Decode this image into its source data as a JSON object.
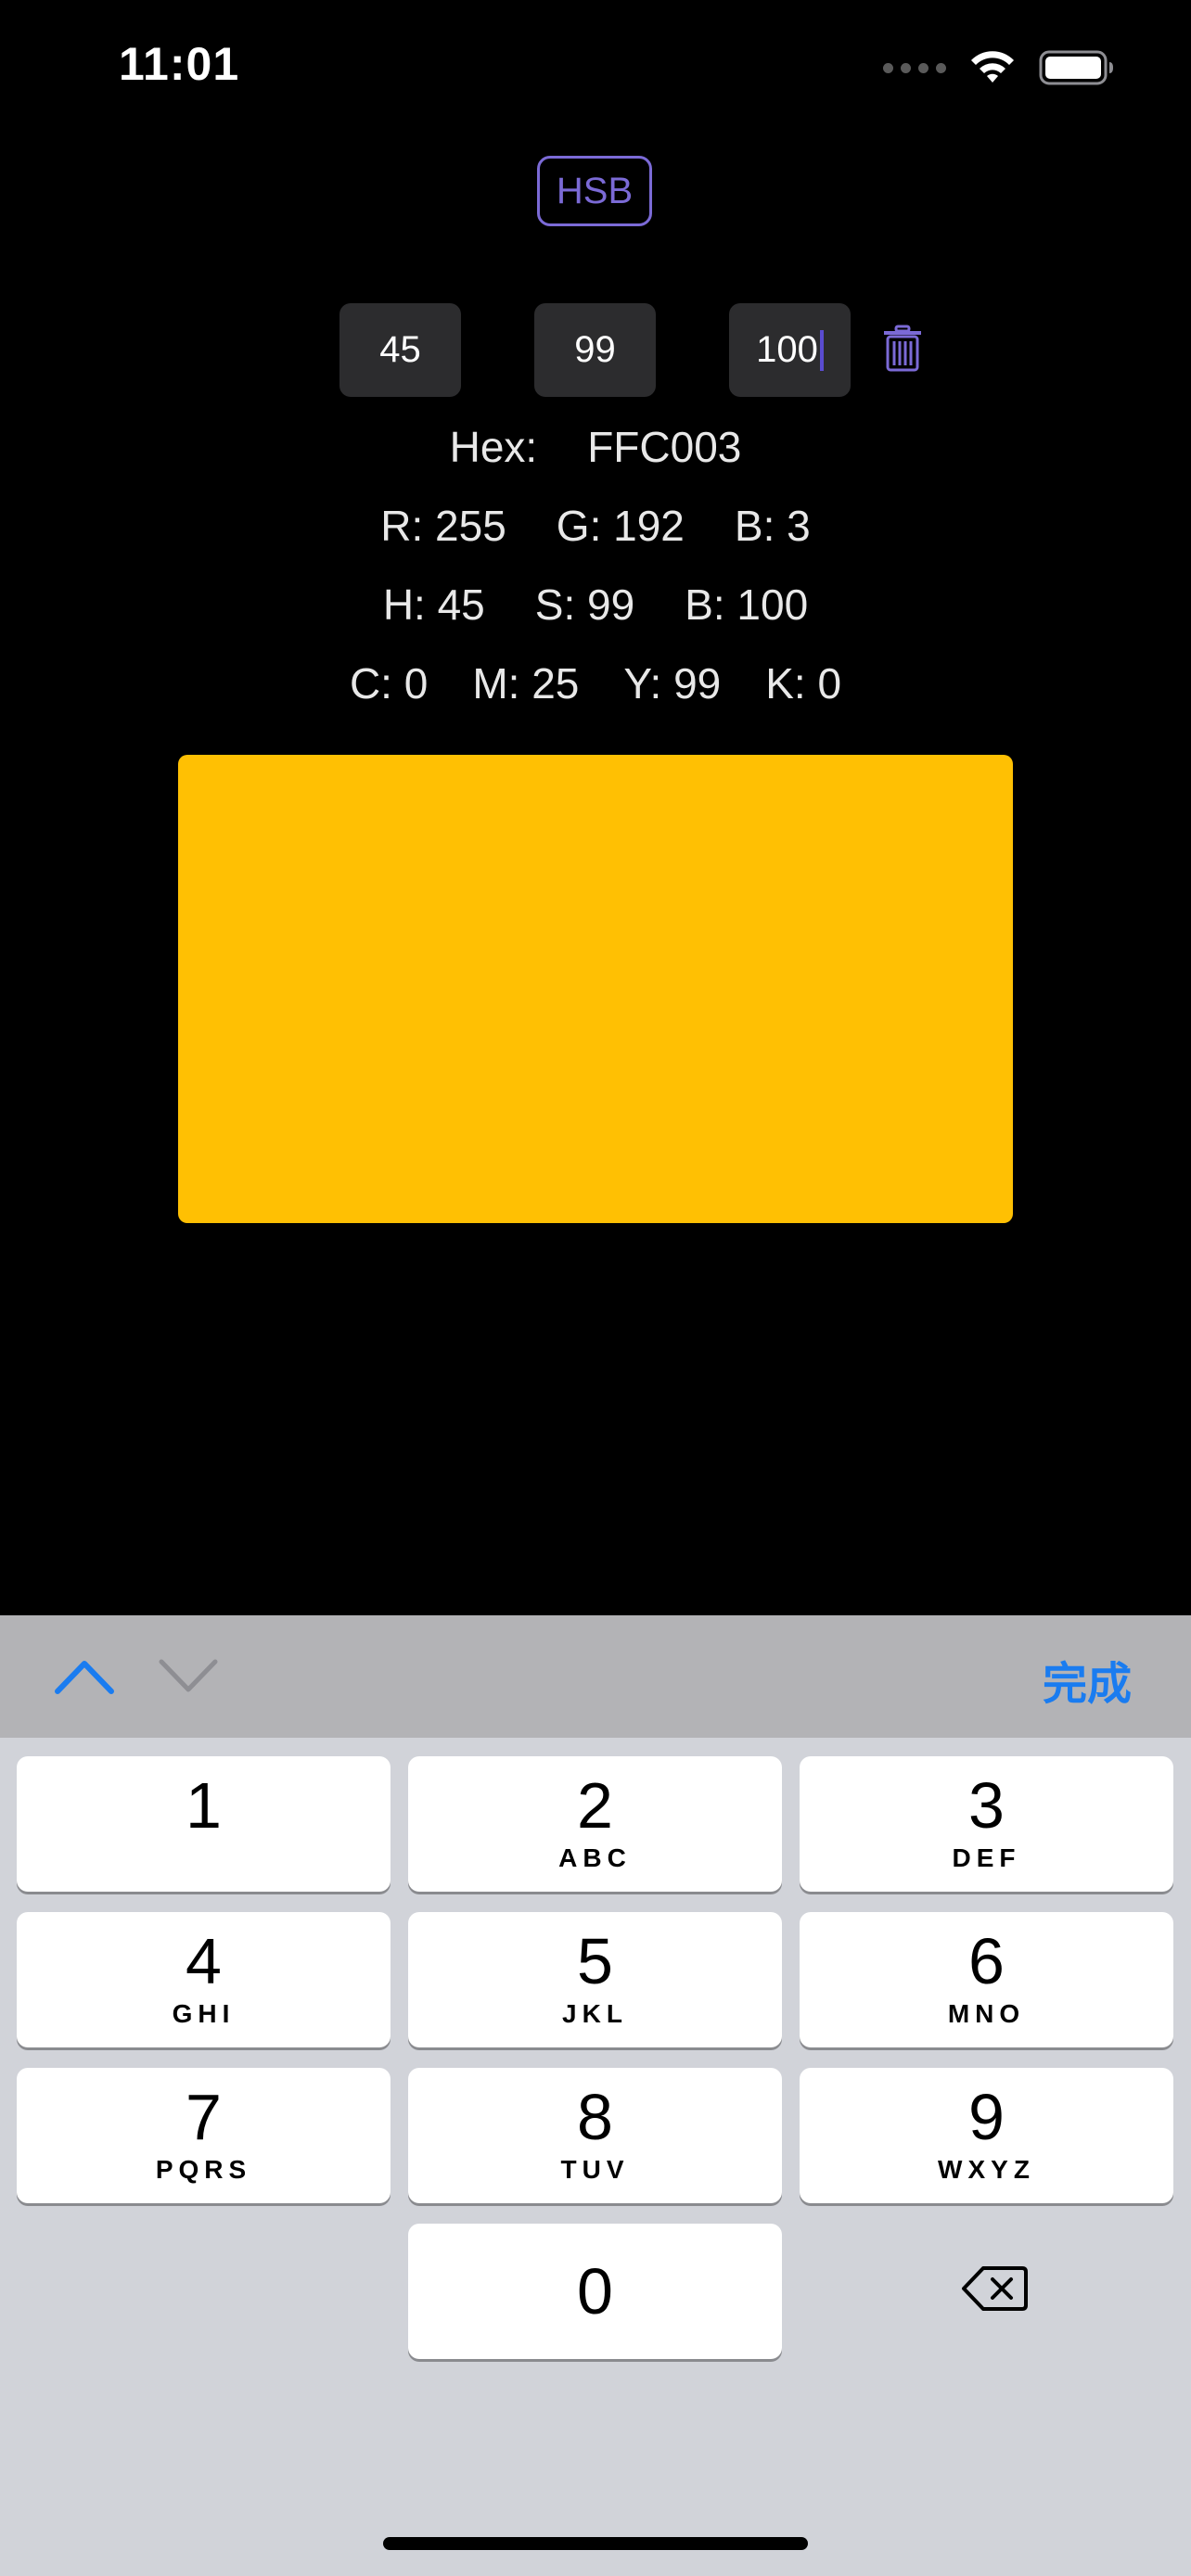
{
  "status_bar": {
    "time": "11:01"
  },
  "mode_button": {
    "label": "HSB",
    "color": "#7b6ad6"
  },
  "inputs": {
    "first": "45",
    "second": "99",
    "third": "100"
  },
  "hex_row": {
    "label": "Hex:",
    "value": "FFC003"
  },
  "rgb_row": {
    "r": "R: 255",
    "g": "G: 192",
    "b": "B: 3"
  },
  "hsb_row": {
    "h": "H: 45",
    "s": "S: 99",
    "b": "B: 100"
  },
  "cmyk_row": {
    "c": "C: 0",
    "m": "M: 25",
    "y": "Y: 99",
    "k": "K: 0"
  },
  "preview": {
    "color": "#FFC003"
  },
  "keyboard": {
    "done_label": "完成",
    "keys": [
      {
        "num": "1",
        "letters": ""
      },
      {
        "num": "2",
        "letters": "ABC"
      },
      {
        "num": "3",
        "letters": "DEF"
      },
      {
        "num": "4",
        "letters": "GHI"
      },
      {
        "num": "5",
        "letters": "JKL"
      },
      {
        "num": "6",
        "letters": "MNO"
      },
      {
        "num": "7",
        "letters": "PQRS"
      },
      {
        "num": "8",
        "letters": "TUV"
      },
      {
        "num": "9",
        "letters": "WXYZ"
      },
      {
        "num": "0",
        "letters": ""
      }
    ],
    "accent_color": "#1a7cf0"
  },
  "icons": {
    "wifi": "wifi-icon",
    "battery": "battery-icon",
    "trash": "trash-icon",
    "up": "chevron-up-icon",
    "down": "chevron-down-icon",
    "backspace": "backspace-icon"
  }
}
